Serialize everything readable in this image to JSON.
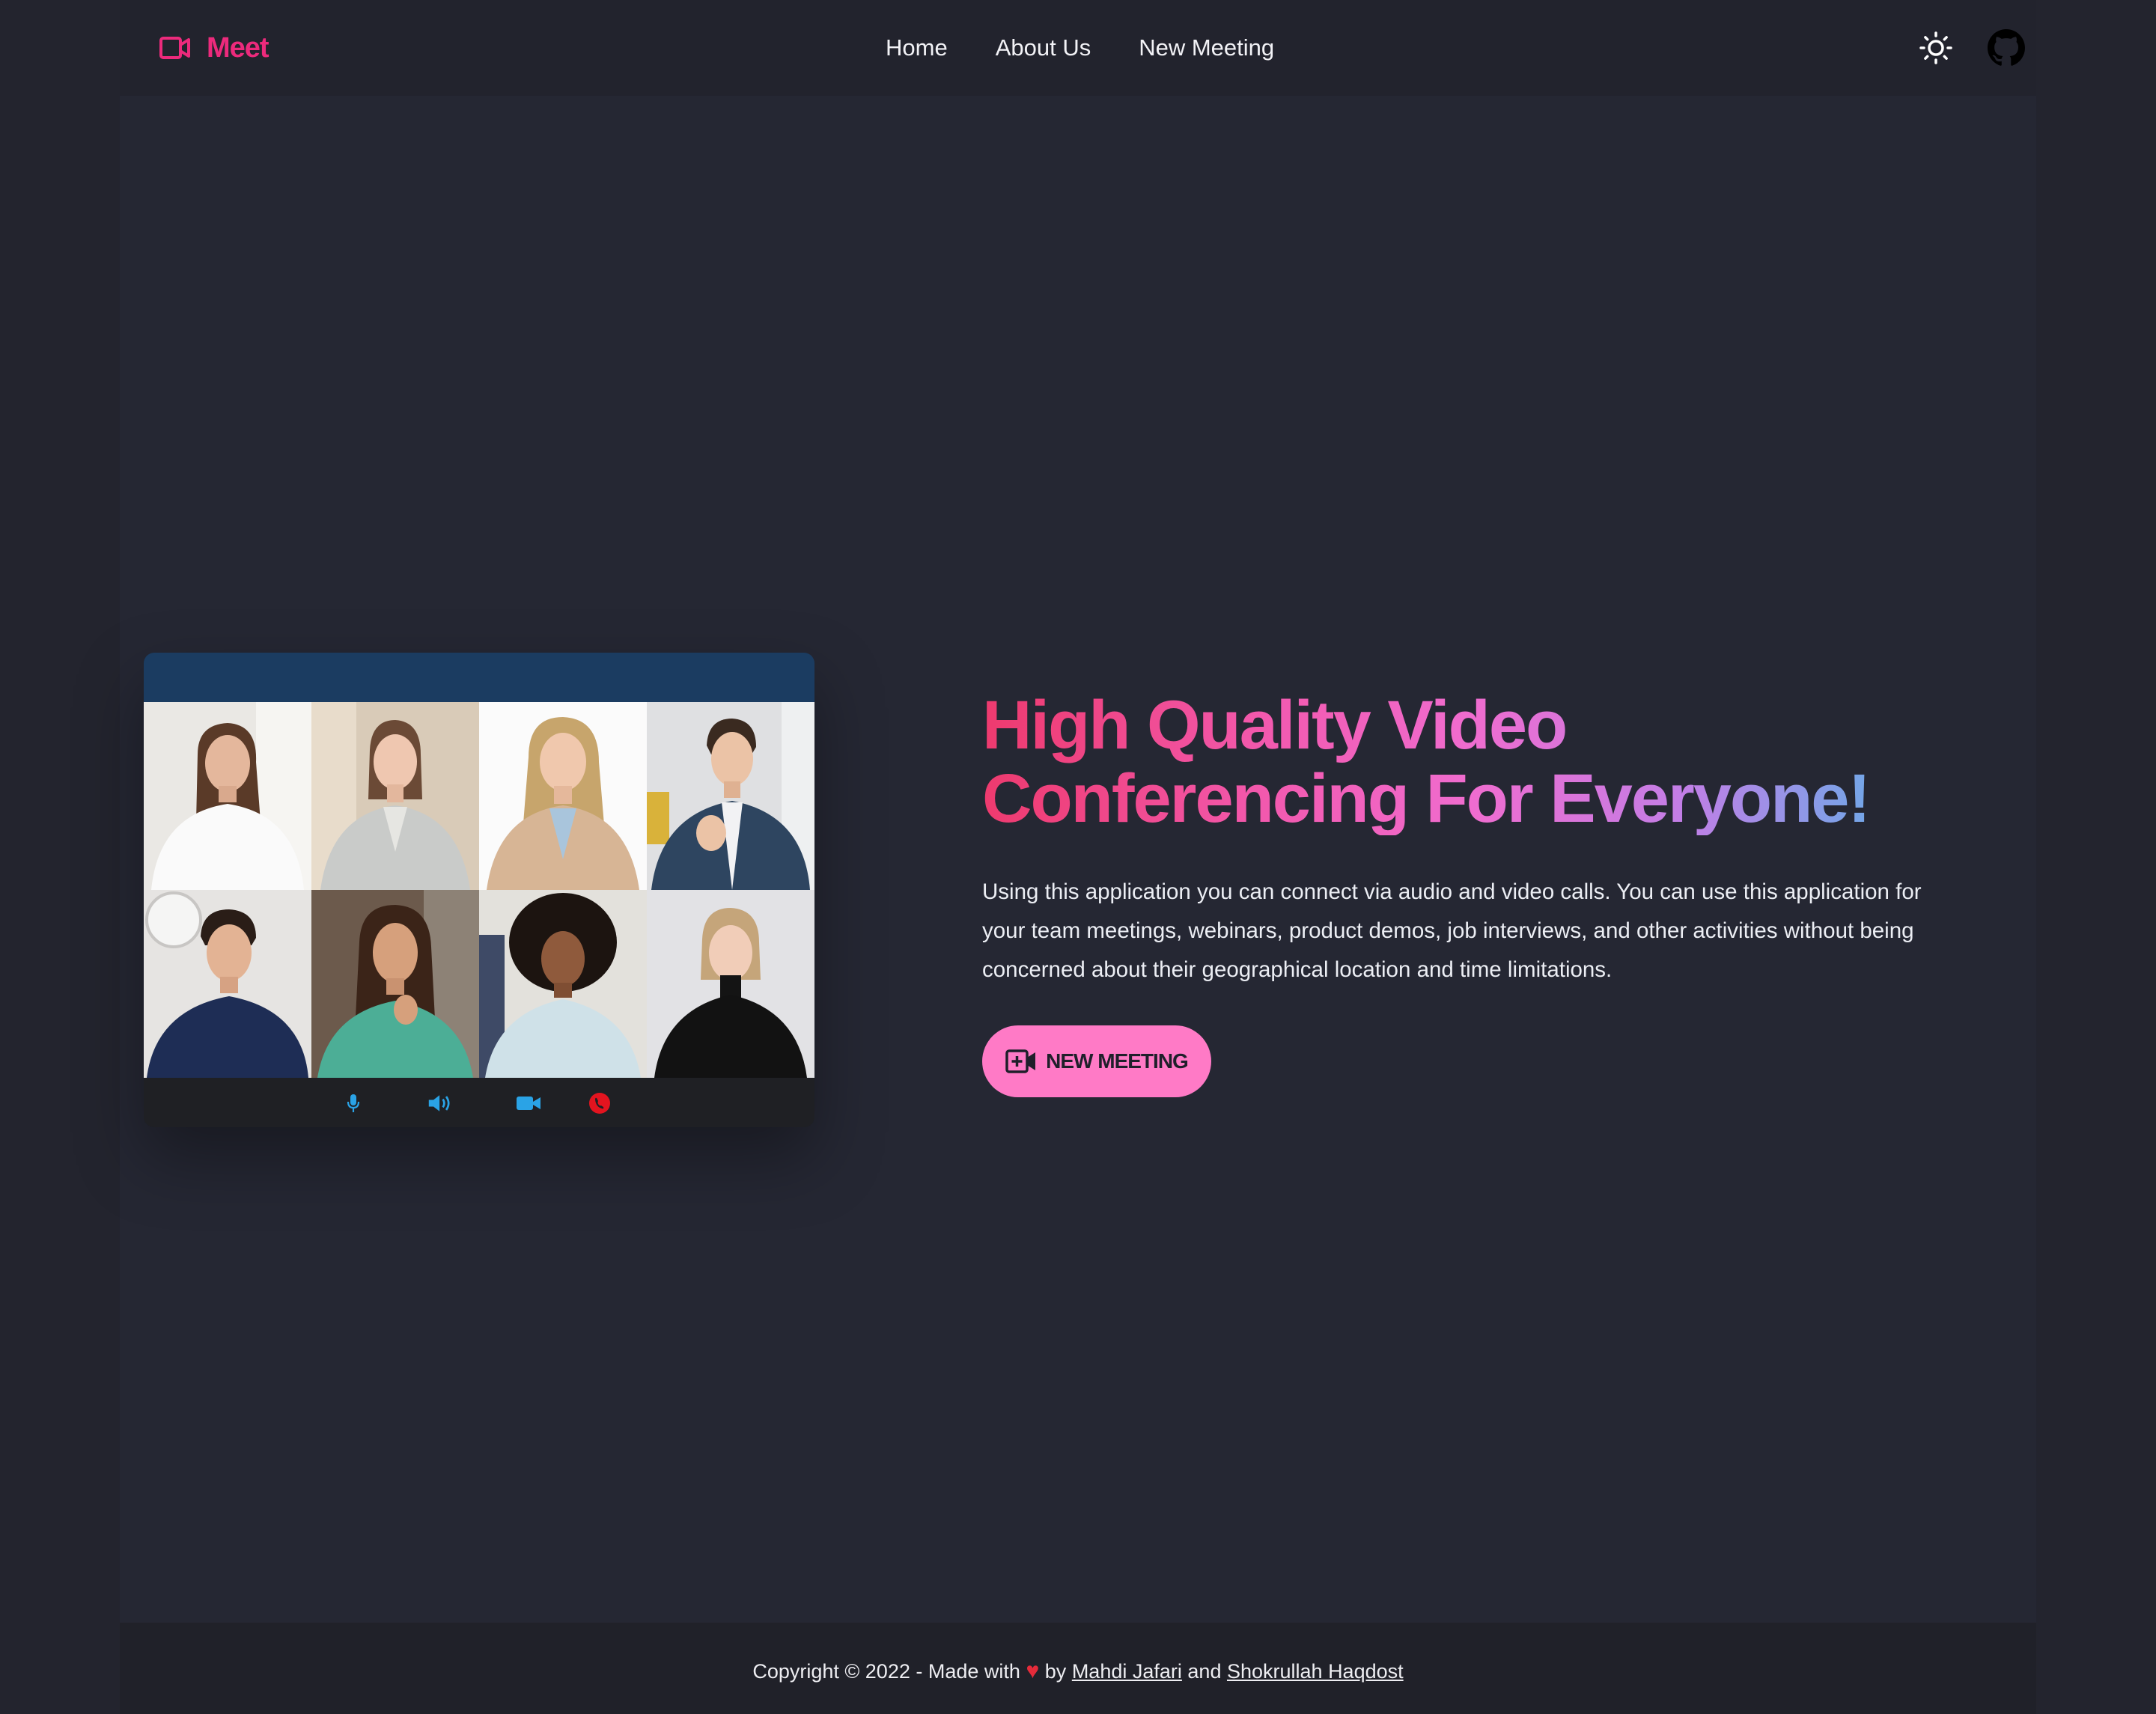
{
  "brand": {
    "name": "Meet",
    "color": "#ec2a7c",
    "icon": "video-camera-icon"
  },
  "nav": {
    "links": [
      {
        "label": "Home"
      },
      {
        "label": "About Us"
      },
      {
        "label": "New Meeting"
      }
    ],
    "theme_toggle_icon": "sun-icon",
    "github_icon": "github-icon"
  },
  "video_preview": {
    "participants": 8,
    "controls": [
      "microphone-icon",
      "speaker-icon",
      "camera-icon",
      "hang-up-icon"
    ]
  },
  "hero": {
    "title_line1": "High Quality Video",
    "title_line2": "Conferencing For Everyone!",
    "description": "Using this application you can connect via audio and video calls. You can use this application for your team meetings, webinars, product demos, job interviews, and other activities without being concerned about their geographical location and time limitations.",
    "cta_label": "NEW MEETING",
    "cta_color": "#ff7ac6"
  },
  "footer": {
    "prefix": "Copyright © 2022 - Made with",
    "heart": "♥",
    "by": "by",
    "author1": "Mahdi Jafari",
    "and": "and",
    "author2": "Shokrullah Haqdost"
  }
}
